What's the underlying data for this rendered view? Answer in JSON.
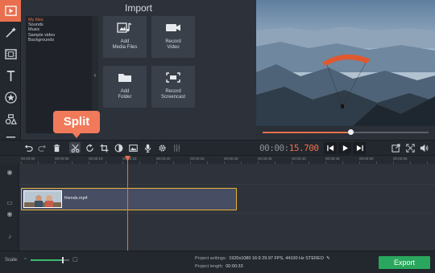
{
  "import_panel": {
    "title": "Import",
    "folders": [
      "My files",
      "Sounds",
      "Music",
      "Sample video",
      "Backgrounds"
    ],
    "selected_folder": "My files",
    "tiles": [
      {
        "label": "Add\nMedia Files",
        "icon": "media-files-icon"
      },
      {
        "label": "Record\nVideo",
        "icon": "camera-icon"
      },
      {
        "label": "Add\nFolder",
        "icon": "folder-icon"
      },
      {
        "label": "Record\nScreencast",
        "icon": "screencast-icon"
      }
    ]
  },
  "rail": [
    "import-icon",
    "magic-wand-icon",
    "filmstrip-icon",
    "titles-icon",
    "star-icon",
    "shapes-icon",
    "menu-icon"
  ],
  "callout": {
    "text": "Split"
  },
  "player": {
    "timecode_dim": "00:00:",
    "timecode_hot": "15.700",
    "seek_progress": 0.53
  },
  "timeline": {
    "ruler_labels": [
      "00:00:00",
      "00:00:05",
      "00:00:10",
      "00:00:15",
      "00:00:20",
      "00:00:25",
      "00:00:30",
      "00:00:35",
      "00:00:40",
      "00:00:45",
      "00:00:50",
      "00:00:55"
    ],
    "clip_name": "friends.mp4"
  },
  "footer": {
    "scale_label": "Scale:",
    "scale_level": 0.82,
    "settings_label": "Project settings:",
    "settings_value": "1920x1080 16:9 29.97 FPS, 44100 Hz STEREO",
    "length_label": "Project length:",
    "length_value": "00:00:33",
    "export_label": "Export"
  },
  "colors": {
    "accent": "#e96f4e",
    "export": "#2aa75e",
    "clip_border": "#e8b23a"
  }
}
